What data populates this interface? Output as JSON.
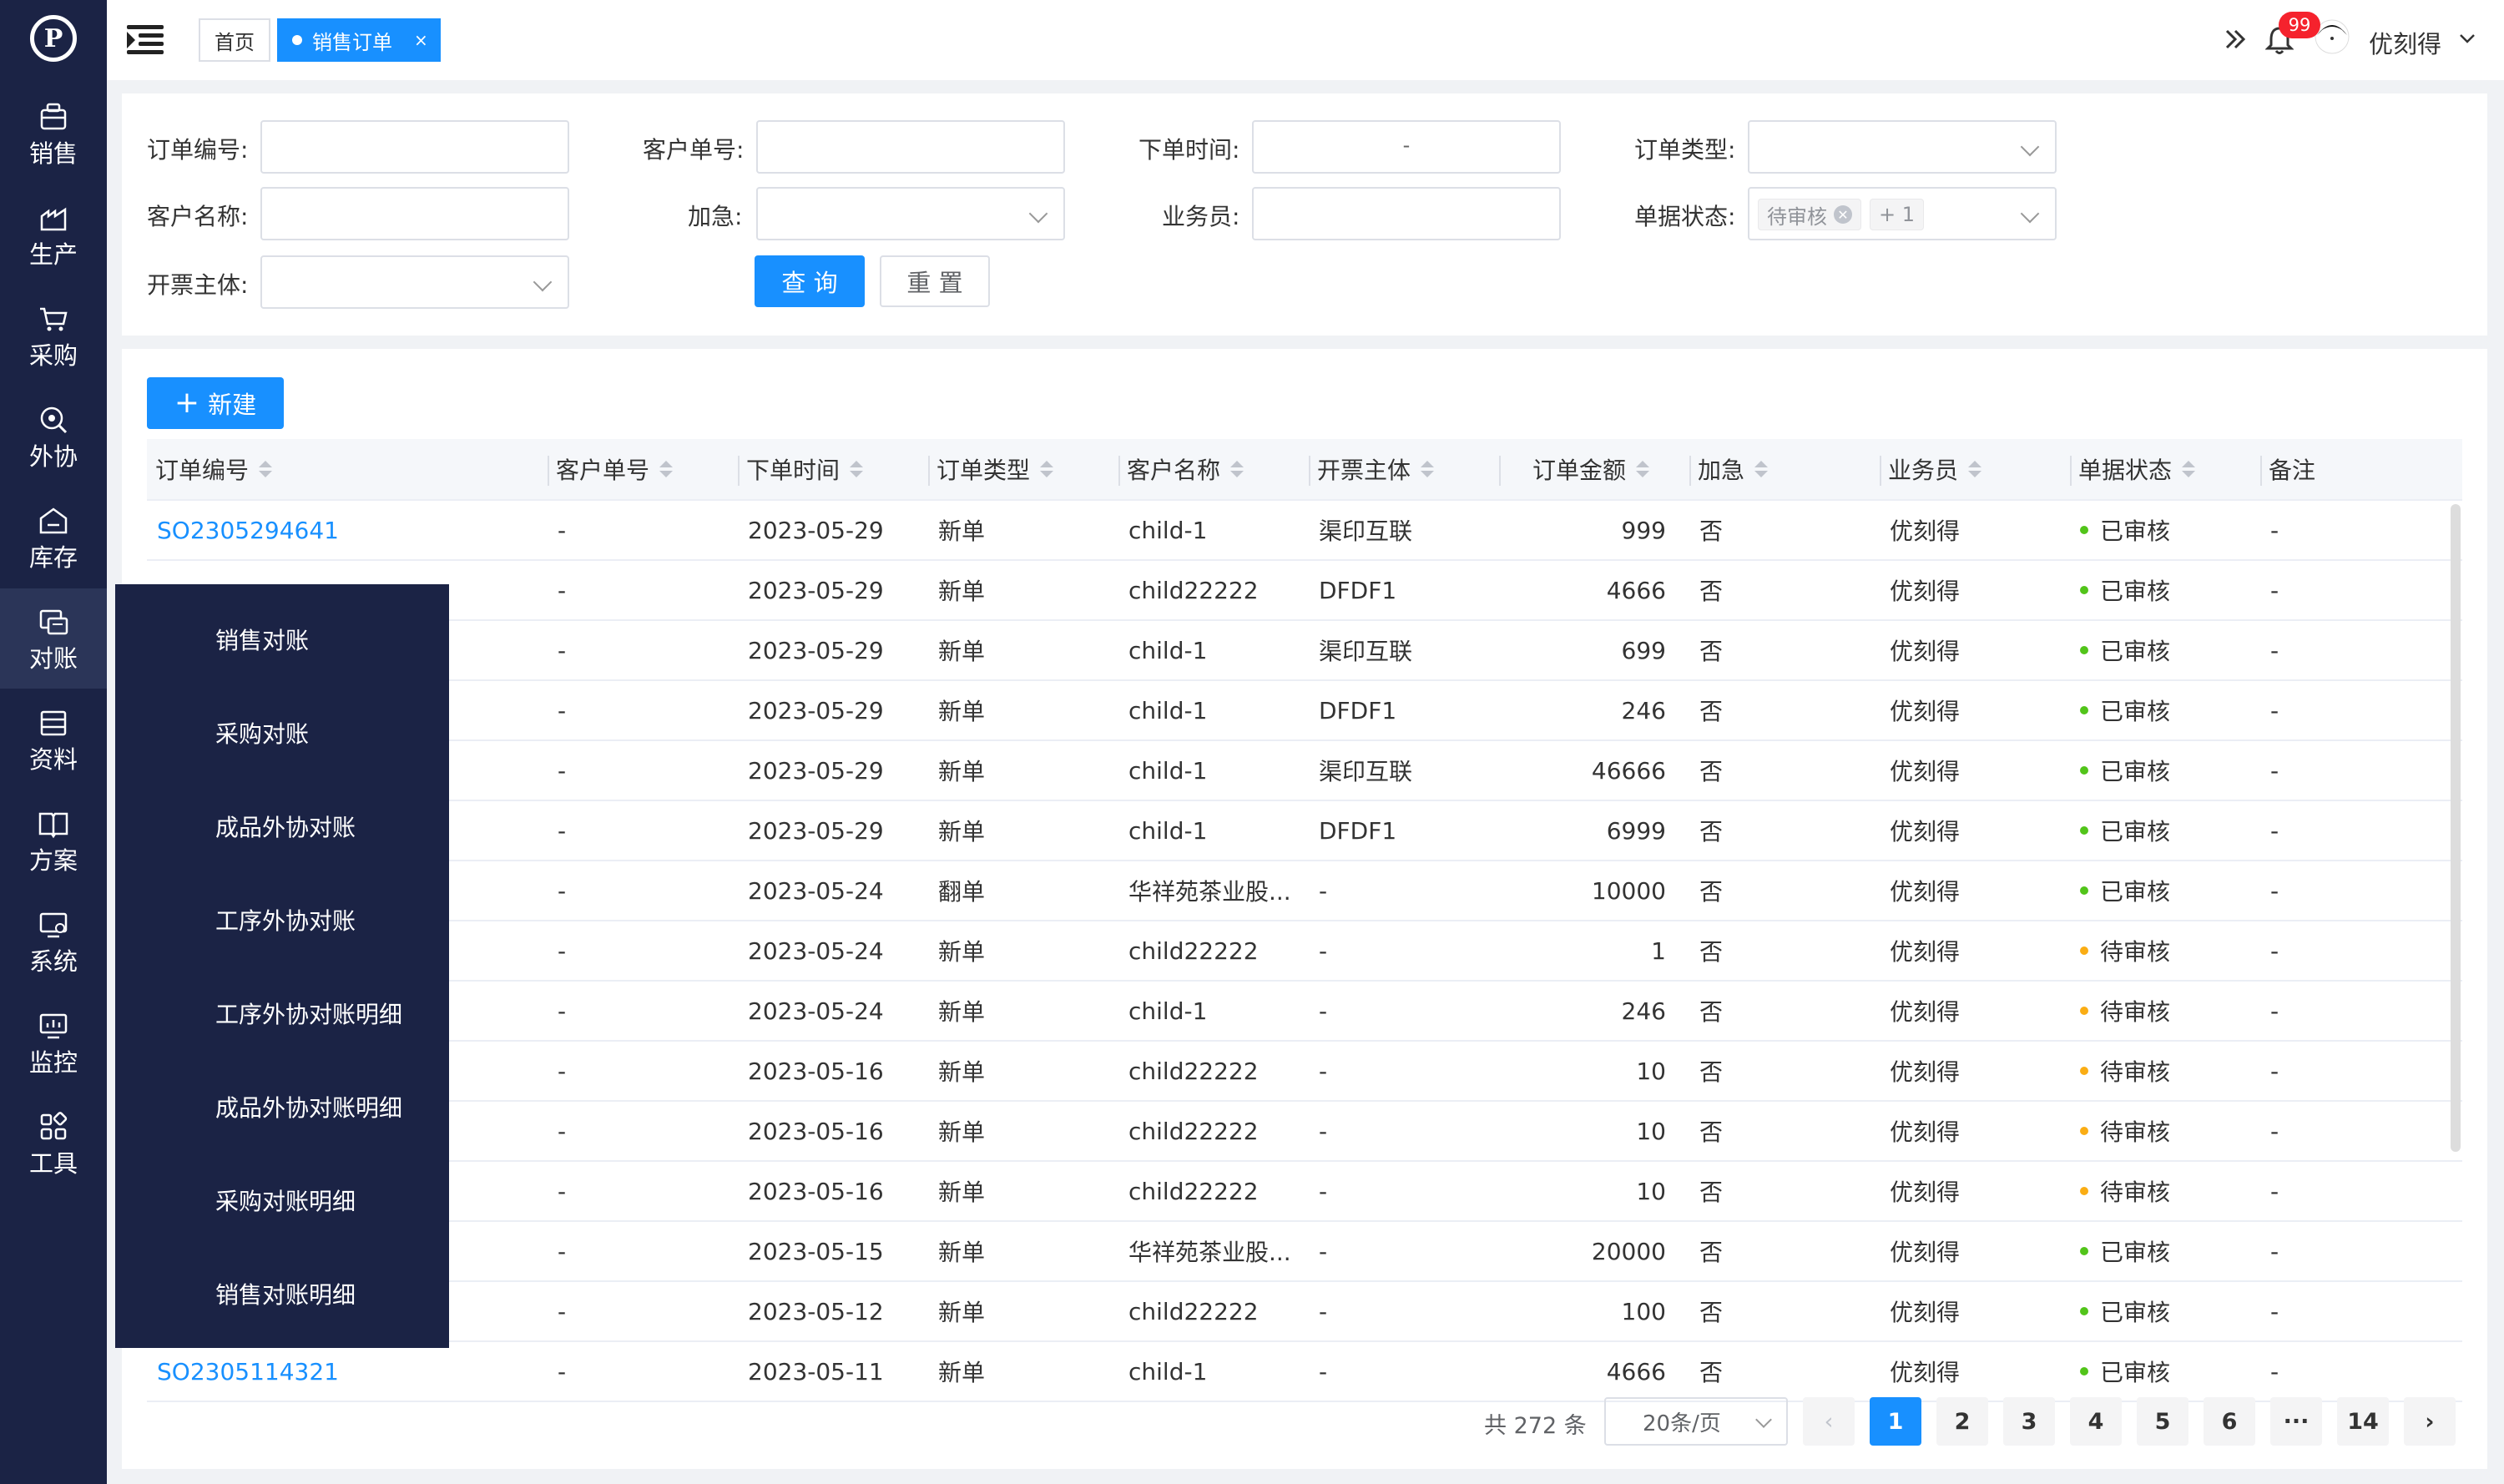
{
  "sidebar": {
    "logo": "P",
    "items": [
      {
        "label": "销售",
        "icon": "sales-icon"
      },
      {
        "label": "生产",
        "icon": "production-icon"
      },
      {
        "label": "采购",
        "icon": "cart-icon"
      },
      {
        "label": "外协",
        "icon": "outsource-icon"
      },
      {
        "label": "库存",
        "icon": "warehouse-icon"
      },
      {
        "label": "对账",
        "icon": "reconcile-icon"
      },
      {
        "label": "资料",
        "icon": "data-icon"
      },
      {
        "label": "方案",
        "icon": "book-icon"
      },
      {
        "label": "系统",
        "icon": "system-icon"
      },
      {
        "label": "监控",
        "icon": "monitor-icon"
      },
      {
        "label": "工具",
        "icon": "tools-icon"
      }
    ],
    "flyout": [
      "销售对账",
      "采购对账",
      "成品外协对账",
      "工序外协对账",
      "工序外协对账明细",
      "成品外协对账明细",
      "采购对账明细",
      "销售对账明细"
    ]
  },
  "header": {
    "tabs": {
      "home": "首页",
      "active": "销售订单",
      "close": "×"
    },
    "notification_count": "99",
    "user_name": "优刻得"
  },
  "filters": {
    "order_no": "订单编号:",
    "customer_no": "客户单号:",
    "order_time": "下单时间:",
    "order_type": "订单类型:",
    "customer_name": "客户名称:",
    "urgent": "加急:",
    "salesman": "业务员:",
    "doc_status": "单据状态:",
    "invoice_entity": "开票主体:",
    "date_separator": "-",
    "status_tag": "待审核",
    "status_more": "+ 1",
    "query_btn": "查 询",
    "reset_btn": "重 置"
  },
  "table": {
    "new_btn": "新建",
    "columns": [
      "订单编号",
      "客户单号",
      "下单时间",
      "订单类型",
      "客户名称",
      "开票主体",
      "订单金额",
      "加急",
      "业务员",
      "单据状态",
      "备注"
    ],
    "rows": [
      {
        "order_no": "SO2305294641",
        "cust_no": "-",
        "date": "2023-05-29",
        "type": "新单",
        "customer": "child-1",
        "invoice": "渠印互联",
        "amount": "999",
        "urgent": "否",
        "salesman": "优刻得",
        "status": "已审核",
        "note": "-"
      },
      {
        "order_no": "",
        "cust_no": "-",
        "date": "2023-05-29",
        "type": "新单",
        "customer": "child22222",
        "invoice": "DFDF1",
        "amount": "4666",
        "urgent": "否",
        "salesman": "优刻得",
        "status": "已审核",
        "note": "-"
      },
      {
        "order_no": "",
        "cust_no": "-",
        "date": "2023-05-29",
        "type": "新单",
        "customer": "child-1",
        "invoice": "渠印互联",
        "amount": "699",
        "urgent": "否",
        "salesman": "优刻得",
        "status": "已审核",
        "note": "-"
      },
      {
        "order_no": "",
        "cust_no": "-",
        "date": "2023-05-29",
        "type": "新单",
        "customer": "child-1",
        "invoice": "DFDF1",
        "amount": "246",
        "urgent": "否",
        "salesman": "优刻得",
        "status": "已审核",
        "note": "-"
      },
      {
        "order_no": "",
        "cust_no": "-",
        "date": "2023-05-29",
        "type": "新单",
        "customer": "child-1",
        "invoice": "渠印互联",
        "amount": "46666",
        "urgent": "否",
        "salesman": "优刻得",
        "status": "已审核",
        "note": "-"
      },
      {
        "order_no": "",
        "cust_no": "-",
        "date": "2023-05-29",
        "type": "新单",
        "customer": "child-1",
        "invoice": "DFDF1",
        "amount": "6999",
        "urgent": "否",
        "salesman": "优刻得",
        "status": "已审核",
        "note": "-"
      },
      {
        "order_no": "",
        "cust_no": "-",
        "date": "2023-05-24",
        "type": "翻单",
        "customer": "华祥苑茶业股...",
        "invoice": "-",
        "amount": "10000",
        "urgent": "否",
        "salesman": "优刻得",
        "status": "已审核",
        "note": "-"
      },
      {
        "order_no": "",
        "cust_no": "-",
        "date": "2023-05-24",
        "type": "新单",
        "customer": "child22222",
        "invoice": "-",
        "amount": "1",
        "urgent": "否",
        "salesman": "优刻得",
        "status": "待审核",
        "note": "-"
      },
      {
        "order_no": "",
        "cust_no": "-",
        "date": "2023-05-24",
        "type": "新单",
        "customer": "child-1",
        "invoice": "-",
        "amount": "246",
        "urgent": "否",
        "salesman": "优刻得",
        "status": "待审核",
        "note": "-"
      },
      {
        "order_no": "",
        "cust_no": "-",
        "date": "2023-05-16",
        "type": "新单",
        "customer": "child22222",
        "invoice": "-",
        "amount": "10",
        "urgent": "否",
        "salesman": "优刻得",
        "status": "待审核",
        "note": "-"
      },
      {
        "order_no": "",
        "cust_no": "-",
        "date": "2023-05-16",
        "type": "新单",
        "customer": "child22222",
        "invoice": "-",
        "amount": "10",
        "urgent": "否",
        "salesman": "优刻得",
        "status": "待审核",
        "note": "-"
      },
      {
        "order_no": "",
        "cust_no": "-",
        "date": "2023-05-16",
        "type": "新单",
        "customer": "child22222",
        "invoice": "-",
        "amount": "10",
        "urgent": "否",
        "salesman": "优刻得",
        "status": "待审核",
        "note": "-"
      },
      {
        "order_no": "",
        "cust_no": "-",
        "date": "2023-05-15",
        "type": "新单",
        "customer": "华祥苑茶业股...",
        "invoice": "-",
        "amount": "20000",
        "urgent": "否",
        "salesman": "优刻得",
        "status": "已审核",
        "note": "-"
      },
      {
        "order_no": "",
        "cust_no": "-",
        "date": "2023-05-12",
        "type": "新单",
        "customer": "child22222",
        "invoice": "-",
        "amount": "100",
        "urgent": "否",
        "salesman": "优刻得",
        "status": "已审核",
        "note": "-"
      },
      {
        "order_no": "SO2305114321",
        "cust_no": "-",
        "date": "2023-05-11",
        "type": "新单",
        "customer": "child-1",
        "invoice": "-",
        "amount": "4666",
        "urgent": "否",
        "salesman": "优刻得",
        "status": "已审核",
        "note": "-"
      }
    ]
  },
  "pagination": {
    "total": "共 272 条",
    "page_size": "20条/页",
    "prev": "‹",
    "next": "›",
    "pages": [
      "1",
      "2",
      "3",
      "4",
      "5",
      "6",
      "···",
      "14"
    ],
    "current": "1"
  },
  "colors": {
    "accent": "#1890ff",
    "sidebar": "#1b2345",
    "approved": "#52c41a",
    "pending": "#faad14"
  }
}
